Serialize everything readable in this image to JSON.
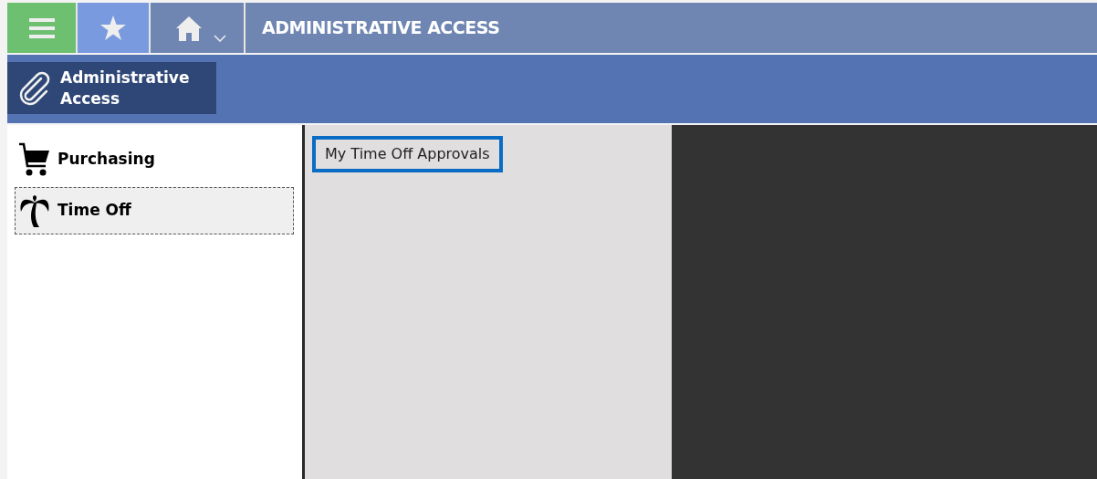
{
  "header": {
    "title": "ADMINISTRATIVE ACCESS"
  },
  "toolbar": {
    "module_button": "Administrative\nAccess"
  },
  "sidebar": {
    "items": [
      {
        "label": "Purchasing",
        "kind": "cart",
        "selected": false
      },
      {
        "label": "Time Off",
        "kind": "palm",
        "selected": true
      }
    ]
  },
  "panel": {
    "links": [
      {
        "label": "My Time Off Approvals",
        "selected": true
      }
    ]
  }
}
